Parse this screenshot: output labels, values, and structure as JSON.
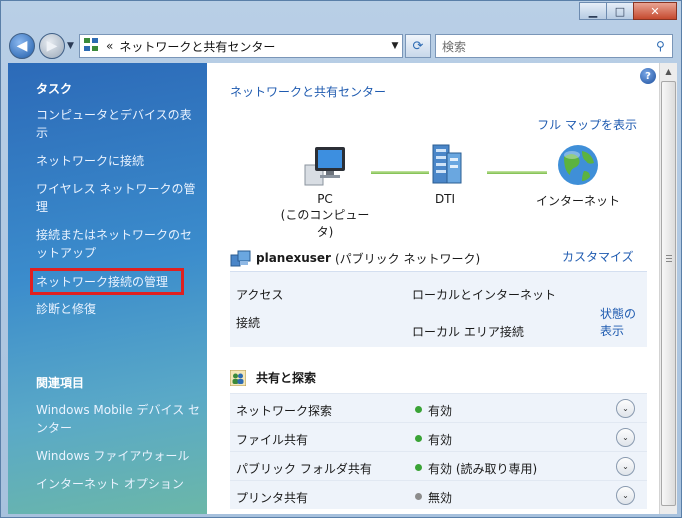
{
  "window": {
    "minimize_glyph": "▁",
    "maximize_glyph": "□",
    "close_glyph": "✕"
  },
  "navigation": {
    "back_glyph": "◀",
    "forward_glyph": "▶",
    "dropdown_glyph": "▼"
  },
  "address": {
    "chevron": "«",
    "path": "ネットワークと共有センター",
    "dropdown_glyph": "▼"
  },
  "refresh_glyph": "⟳",
  "search": {
    "placeholder": "検索",
    "icon_glyph": "⚲"
  },
  "taskpane": {
    "tasks_heading": "タスク",
    "tasks": [
      "コンピュータとデバイスの表示",
      "ネットワークに接続",
      "ワイヤレス ネットワークの管理",
      "接続またはネットワークのセットアップ",
      "ネットワーク接続の管理",
      "診断と修復"
    ],
    "related_heading": "関連項目",
    "related": [
      "Windows Mobile デバイス センター",
      "Windows ファイアウォール",
      "インターネット オプション"
    ]
  },
  "content": {
    "help_glyph": "?",
    "title": "ネットワークと共有センター",
    "full_map_link": "フル マップを表示",
    "map": {
      "pc_label": "PC",
      "pc_sublabel": "(このコンピュータ)",
      "network_label": "DTI",
      "internet_label": "インターネット"
    },
    "network": {
      "name": "planexuser",
      "type": "(パブリック ネットワーク)",
      "customize_link": "カスタマイズ",
      "access_label": "アクセス",
      "access_value": "ローカルとインターネット",
      "connection_label": "接続",
      "connection_value": "ローカル エリア接続",
      "status_link": "状態の表示"
    },
    "sharing": {
      "title": "共有と探索",
      "expand_glyph": "⌄",
      "rows": [
        {
          "label": "ネットワーク探索",
          "status": "有効",
          "dot_color": "#3aa336"
        },
        {
          "label": "ファイル共有",
          "status": "有効",
          "dot_color": "#3aa336"
        },
        {
          "label": "パブリック フォルダ共有",
          "status": "有効 (読み取り専用)",
          "dot_color": "#3aa336"
        },
        {
          "label": "プリンタ共有",
          "status": "無効",
          "dot_color": "#8c8c8c"
        }
      ]
    }
  },
  "colors": {
    "link": "#1f5bb0",
    "highlight_box": "#e02020",
    "enabled_dot": "#3aa336",
    "disabled_dot": "#8c8c8c"
  }
}
